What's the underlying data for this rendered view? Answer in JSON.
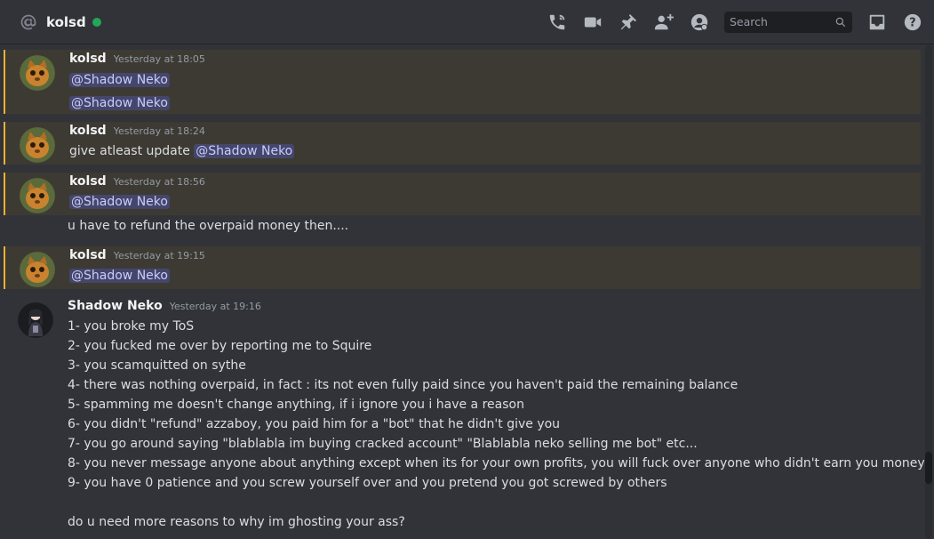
{
  "header": {
    "channel_name": "kolsd",
    "status": "online",
    "search_placeholder": "Search",
    "icons": [
      "at-icon",
      "call-icon",
      "video-icon",
      "pin-icon",
      "add-friend-icon",
      "profile-icon",
      "search-icon",
      "inbox-icon",
      "help-icon"
    ]
  },
  "messages": [
    {
      "author": "kolsd",
      "timestamp": "Yesterday at 18:05",
      "lines": [
        {
          "mention": "@Shadow Neko"
        },
        {
          "mention": "@Shadow Neko"
        }
      ]
    },
    {
      "author": "kolsd",
      "timestamp": "Yesterday at 18:24",
      "lines": [
        {
          "text": "give atleast update",
          "mention": "@Shadow Neko"
        }
      ]
    },
    {
      "author": "kolsd",
      "timestamp": "Yesterday at 18:56",
      "lines": [
        {
          "mention": "@Shadow Neko"
        },
        {
          "text": "u have to refund the overpaid money then...."
        }
      ]
    },
    {
      "author": "kolsd",
      "timestamp": "Yesterday at 19:15",
      "lines": [
        {
          "mention": "@Shadow Neko"
        }
      ]
    },
    {
      "author": "Shadow Neko",
      "timestamp": "Yesterday at 19:16",
      "lines": [
        {
          "text": "1- you broke my ToS"
        },
        {
          "text": "2- you fucked me over by reporting me to Squire"
        },
        {
          "text": "3- you scamquitted on sythe"
        },
        {
          "text": "4- there was nothing overpaid, in fact : its not even fully paid since you haven't paid the remaining balance"
        },
        {
          "text": "5- spamming me doesn't change anything, if i ignore you i have a reason"
        },
        {
          "text": "6- you didn't \"refund\" azzaboy, you paid him for a \"bot\" that he didn't give you"
        },
        {
          "text": "7- you go around saying \"blablabla im buying cracked account\" \"Blablabla neko selling me bot\" etc..."
        },
        {
          "text": "8- you never message anyone about anything except when its for your own profits, you will fuck over anyone who didn't earn you money"
        },
        {
          "text": "9- you have 0 patience and you screw yourself over and you pretend you got screwed by others"
        },
        {
          "text": ""
        },
        {
          "text": "do u need more reasons to why im ghosting your ass?"
        }
      ]
    }
  ]
}
